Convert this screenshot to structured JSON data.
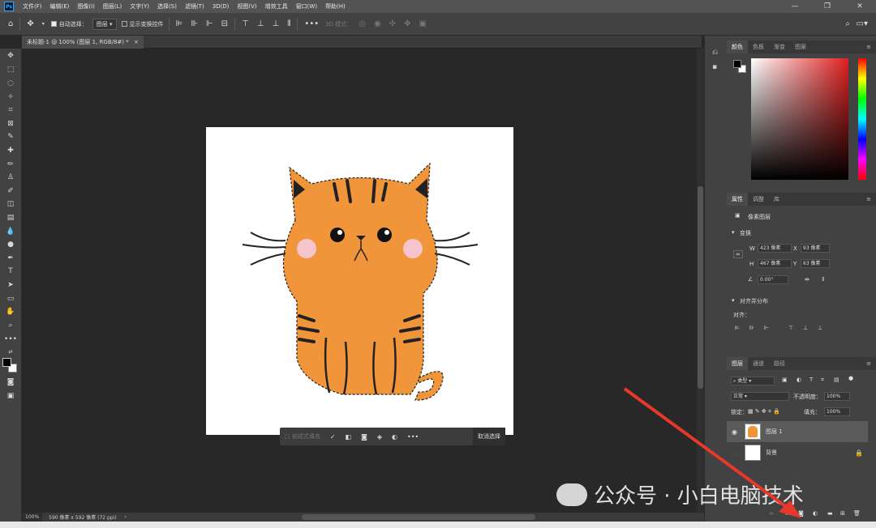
{
  "app": {
    "logo": "Ps"
  },
  "menu": [
    "文件(F)",
    "编辑(E)",
    "图像(I)",
    "图层(L)",
    "文字(Y)",
    "选择(S)",
    "滤镜(T)",
    "3D(D)",
    "视图(V)",
    "增效工具",
    "窗口(W)",
    "帮助(H)"
  ],
  "window_controls": {
    "minimize": "—",
    "restore": "❐",
    "close": "✕"
  },
  "options": {
    "auto_select_label": "自动选择：",
    "auto_select_value": "图层",
    "show_transform_label": "显示变换控件",
    "mode_3d_label": "3D 模式："
  },
  "document": {
    "tab_title": "未标题-1 @ 100% (图层 1, RGB/8#) *",
    "close": "×"
  },
  "context_bar": {
    "fill_label": "创成式填充",
    "deselect_label": "取消选择"
  },
  "status": {
    "zoom": "100%",
    "doc_info": "590 像素 x 592 像素 (72 ppi)"
  },
  "color_panel": {
    "tabs": [
      "颜色",
      "色板",
      "渐变",
      "图案"
    ]
  },
  "properties_panel": {
    "tabs": [
      "属性",
      "调整",
      "库"
    ],
    "layer_type": "像素图层",
    "transform_title": "变换",
    "W_label": "W",
    "W": "423 像素",
    "X_label": "X",
    "X": "93 像素",
    "H_label": "H",
    "H": "467 像素",
    "Y_label": "Y",
    "Y": "63 像素",
    "angle": "0.00°",
    "align_title": "对齐并分布",
    "align_label": "对齐："
  },
  "layers_panel": {
    "tabs": [
      "图层",
      "通道",
      "路径"
    ],
    "filter_label": "类型",
    "blend_mode": "正常",
    "opacity_label": "不透明度：",
    "opacity": "100%",
    "lock_label": "锁定：",
    "fill_label": "填充：",
    "fill": "100%",
    "layers": [
      {
        "name": "图层 1"
      },
      {
        "name": "背景"
      }
    ]
  },
  "watermark": "公众号 · 小白电脑技术",
  "colors": {
    "cat_orange": "#f0953a",
    "cheek_pink": "#f5c4cc",
    "arrow_red": "#e8382a"
  }
}
